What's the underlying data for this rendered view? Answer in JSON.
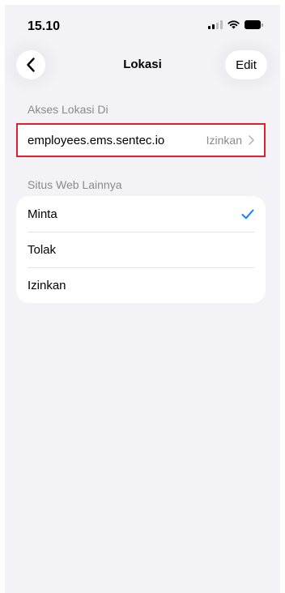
{
  "status_bar": {
    "time": "15.10"
  },
  "nav": {
    "title": "Lokasi",
    "edit_label": "Edit"
  },
  "access_section": {
    "header": "Akses Lokasi Di",
    "site": {
      "domain": "employees.ems.sentec.io",
      "value": "Izinkan"
    }
  },
  "other_sites_section": {
    "header": "Situs Web Lainnya",
    "options": [
      {
        "label": "Minta",
        "selected": true
      },
      {
        "label": "Tolak",
        "selected": false
      },
      {
        "label": "Izinkan",
        "selected": false
      }
    ]
  },
  "colors": {
    "accent": "#0a84ff",
    "highlight_border": "#e0202f",
    "background": "#f2f2f7"
  }
}
